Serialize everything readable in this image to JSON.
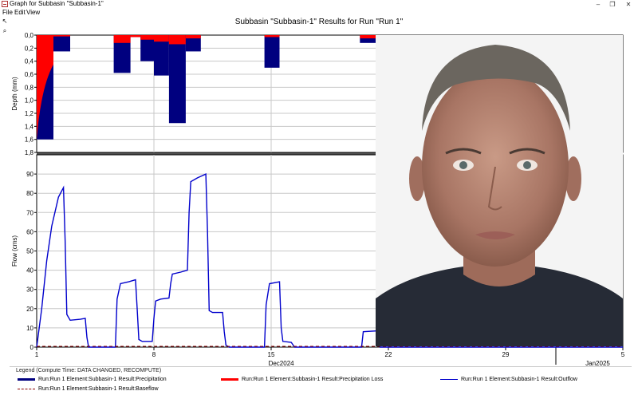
{
  "window": {
    "title": "Graph for Subbasin \"Subbasin-1\"",
    "minimize": "–",
    "maximize": "❐",
    "close": "✕"
  },
  "menu": [
    "File",
    "Edit",
    "View"
  ],
  "tools": {
    "pointer": "↖",
    "zoom": "⌕"
  },
  "colors": {
    "precipitation": "#00007f",
    "loss": "#ff0000",
    "outflow": "#0000cc",
    "baseflow": "#8b0000",
    "grid": "#c8c8c8"
  },
  "chart_data": [
    {
      "type": "bar",
      "title": "Subbasin \"Subbasin-1\" Results for Run \"Run 1\"",
      "ylabel": "Depth (mm)",
      "ylim": [
        1.8,
        0.0
      ],
      "y_inverted": true,
      "y_ticks": [
        "0,0",
        "0,2",
        "0,4",
        "0,6",
        "0,8",
        "1,0",
        "1,2",
        "1,4",
        "1,6",
        "1,8"
      ],
      "xlim_days": [
        1,
        36
      ],
      "series": [
        {
          "name": "Run:Run 1 Element:Subbasin-1 Result:Precipitation",
          "values": [
            {
              "start": 1,
              "end": 2,
              "total": 1.6,
              "loss": 1.6,
              "loss_shape": "curve"
            },
            {
              "start": 2,
              "end": 3,
              "total": 0.25,
              "loss": 0.02
            },
            {
              "start": 5.6,
              "end": 6.6,
              "total": 0.58,
              "loss": 0.12
            },
            {
              "start": 6.6,
              "end": 7.2,
              "total": 0.03,
              "loss": 0.03
            },
            {
              "start": 7.2,
              "end": 8.0,
              "total": 0.4,
              "loss": 0.07
            },
            {
              "start": 8.0,
              "end": 8.9,
              "total": 0.62,
              "loss": 0.1
            },
            {
              "start": 8.9,
              "end": 9.9,
              "total": 1.35,
              "loss": 0.14
            },
            {
              "start": 9.9,
              "end": 10.8,
              "total": 0.25,
              "loss": 0.05
            },
            {
              "start": 14.6,
              "end": 15.5,
              "total": 0.5,
              "loss": 0.03
            },
            {
              "start": 20.3,
              "end": 21.4,
              "total": 0.12,
              "loss": 0.05
            }
          ]
        },
        {
          "name": "Run:Run 1 Element:Subbasin-1 Result:Precipitation Loss",
          "values": "stacked above, see loss"
        }
      ]
    },
    {
      "type": "line",
      "ylabel": "Flow (cms)",
      "ylim": [
        0,
        100
      ],
      "y_ticks": [
        "0",
        "10",
        "20",
        "30",
        "40",
        "50",
        "60",
        "70",
        "80",
        "90"
      ],
      "xlim_days": [
        1,
        36
      ],
      "x_ticks": [
        {
          "day": 1,
          "label": "1"
        },
        {
          "day": 8,
          "label": "8"
        },
        {
          "day": 15,
          "label": "15"
        },
        {
          "day": 22,
          "label": "22"
        },
        {
          "day": 29,
          "label": "29"
        },
        {
          "day": 36,
          "label": "5"
        }
      ],
      "x_period_labels": [
        {
          "day": 15.6,
          "label": "Dec2024"
        },
        {
          "day": 34.5,
          "label": "Jan2025"
        }
      ],
      "x_period_separators": [
        32
      ],
      "series": [
        {
          "name": "Run:Run 1 Element:Subbasin-1 Result:Outflow",
          "points": [
            [
              1,
              0
            ],
            [
              1.3,
              20
            ],
            [
              1.6,
              45
            ],
            [
              1.9,
              63
            ],
            [
              2.3,
              78
            ],
            [
              2.6,
              83
            ],
            [
              2.7,
              55
            ],
            [
              2.8,
              17
            ],
            [
              3.0,
              14
            ],
            [
              3.6,
              14.5
            ],
            [
              3.9,
              15
            ],
            [
              4.0,
              5
            ],
            [
              4.1,
              0
            ],
            [
              5.7,
              0
            ],
            [
              5.8,
              25
            ],
            [
              6.0,
              33
            ],
            [
              6.5,
              34
            ],
            [
              6.9,
              35
            ],
            [
              7.0,
              20
            ],
            [
              7.1,
              4
            ],
            [
              7.3,
              3
            ],
            [
              7.9,
              3
            ],
            [
              8.0,
              15
            ],
            [
              8.1,
              24
            ],
            [
              8.4,
              25
            ],
            [
              8.9,
              25.5
            ],
            [
              9.0,
              33
            ],
            [
              9.1,
              38
            ],
            [
              9.6,
              39
            ],
            [
              10.0,
              40
            ],
            [
              10.1,
              70
            ],
            [
              10.2,
              86
            ],
            [
              10.6,
              88
            ],
            [
              11.1,
              90
            ],
            [
              11.2,
              60
            ],
            [
              11.3,
              19
            ],
            [
              11.5,
              18
            ],
            [
              12.1,
              18
            ],
            [
              12.2,
              8
            ],
            [
              12.3,
              1
            ],
            [
              12.5,
              0
            ],
            [
              14.6,
              0
            ],
            [
              14.7,
              22
            ],
            [
              14.9,
              33
            ],
            [
              15.5,
              34
            ],
            [
              15.6,
              10
            ],
            [
              15.7,
              3
            ],
            [
              16.2,
              2.5
            ],
            [
              16.4,
              0
            ],
            [
              20.4,
              0
            ],
            [
              20.5,
              8
            ],
            [
              21.4,
              8.5
            ],
            [
              21.5,
              0
            ],
            [
              36,
              0
            ]
          ]
        },
        {
          "name": "Run:Run 1 Element:Subbasin-1 Result:Baseflow",
          "points": [
            [
              1,
              0
            ],
            [
              36,
              0
            ]
          ]
        }
      ]
    }
  ],
  "legend": {
    "heading": "Legend (Compute Time: DATA CHANGED, RECOMPUTE)",
    "items": [
      {
        "label": "Run:Run 1 Element:Subbasin-1 Result:Precipitation",
        "color": "#00007f",
        "style": "thick"
      },
      {
        "label": "Run:Run 1 Element:Subbasin-1 Result:Precipitation Loss",
        "color": "#ff0000",
        "style": "thick"
      },
      {
        "label": "Run:Run 1 Element:Subbasin-1 Result:Outflow",
        "color": "#0000cc",
        "style": "thin"
      },
      {
        "label": "Run:Run 1 Element:Subbasin-1 Result:Baseflow",
        "color": "#8b0000",
        "style": "dashed"
      }
    ]
  }
}
